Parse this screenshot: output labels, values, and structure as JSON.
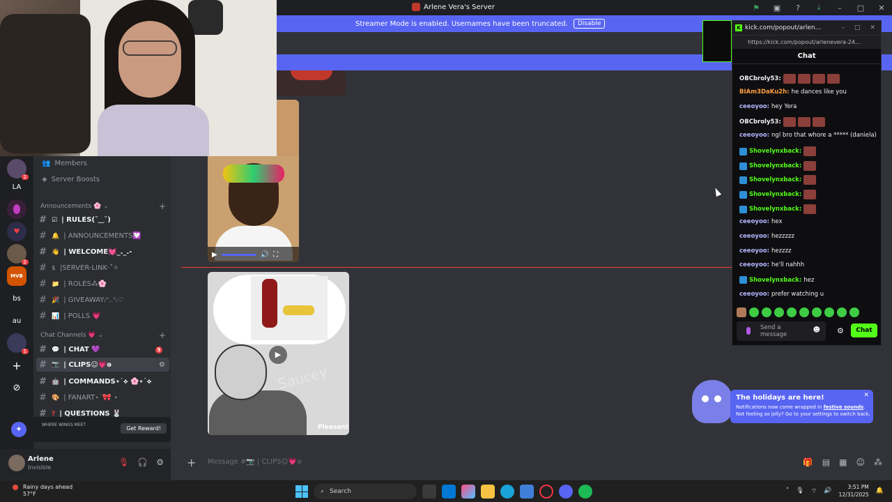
{
  "window": {
    "server_title": "Arlene Vera's Server",
    "streamer_banner": "Streamer Mode is enabled. Usernames have been truncated.",
    "disable_label": "Disable"
  },
  "guilds": [
    {
      "label": "",
      "badge": "2"
    },
    {
      "label": "LA",
      "badge": ""
    },
    {
      "label": "",
      "badge": ""
    },
    {
      "label": "",
      "badge": ""
    },
    {
      "label": "",
      "badge": "2"
    },
    {
      "label": "MVB",
      "badge": ""
    },
    {
      "label": "bs",
      "badge": ""
    },
    {
      "label": "au",
      "badge": ""
    },
    {
      "label": "",
      "badge": "1"
    },
    {
      "label": "+",
      "badge": ""
    },
    {
      "label": "⊘",
      "badge": ""
    }
  ],
  "sidebar": {
    "top_items": [
      {
        "label": "Members"
      },
      {
        "label": "Server Boosts"
      }
    ],
    "category_announcements": "Announcements 🌸",
    "announcement_channels": [
      {
        "label": "| RULES(˘‿˘)",
        "bold": true
      },
      {
        "label": "| ANNOUNCEMENTS💟",
        "bold": false
      },
      {
        "label": "| WELCOME💓_._.-",
        "bold": true
      },
      {
        "label": "|SERVER-LINK·˚✧",
        "bold": false
      },
      {
        "label": "| ROLES⁂🌸",
        "bold": false
      },
      {
        "label": "| GIVEAWAY₍ᐢ..ᐢ₎♡",
        "bold": false
      },
      {
        "label": "| POLLS 💗",
        "bold": false
      }
    ],
    "category_chat": "Chat Channels 💗",
    "chat_channels": [
      {
        "label": "| CHAT 💜",
        "bold": true,
        "badge": "5"
      },
      {
        "label": "| CLIPS☺💗ə",
        "bold": true,
        "badge": ""
      },
      {
        "label": "| COMMANDS⋆˙⟡ 🌸⋆˙⟡",
        "bold": true,
        "badge": ""
      },
      {
        "label": "| FANART⋆˙🎀 ⋆",
        "bold": false,
        "badge": ""
      },
      {
        "label": "| QUESTIONS 🐰",
        "bold": true,
        "badge": ""
      }
    ]
  },
  "promo": {
    "text": "WHERE WINGS MEET",
    "button": "Get Reward!"
  },
  "user": {
    "name": "Arlene",
    "status": "Invisible"
  },
  "composer": {
    "placeholder": "Message #📷 | CLIPS☺💗ə"
  },
  "kick_chat": {
    "window_title": "kick.com/popout/arlen...",
    "url": "https://kick.com/popout/arlenevera-24...",
    "header": "Chat",
    "messages": [
      {
        "user": "OBCbroly53:",
        "text": "",
        "color": "#efeff1",
        "emotes": 4,
        "icon": false
      },
      {
        "user": "BIAm3DaKu2h:",
        "text": "he dances like you",
        "color": "#ff9f43",
        "emotes": 0,
        "icon": false
      },
      {
        "user": "ceeoyoo:",
        "text": "hey Yera",
        "color": "#b3b3ff",
        "emotes": 0,
        "icon": false
      },
      {
        "user": "OBCbroly53:",
        "text": "",
        "color": "#efeff1",
        "emotes": 3,
        "icon": false
      },
      {
        "user": "ceeoyoo:",
        "text": "ngl bro that whore a ***** (daniela)",
        "color": "#b3b3ff",
        "emotes": 0,
        "icon": false
      },
      {
        "user": "Shovelynxback:",
        "text": "",
        "color": "#53fc18",
        "emotes": 1,
        "icon": true
      },
      {
        "user": "Shovelynxback:",
        "text": "",
        "color": "#53fc18",
        "emotes": 1,
        "icon": true
      },
      {
        "user": "Shovelynxback:",
        "text": "",
        "color": "#53fc18",
        "emotes": 1,
        "icon": true
      },
      {
        "user": "Shovelynxback:",
        "text": "",
        "color": "#53fc18",
        "emotes": 1,
        "icon": true
      },
      {
        "user": "Shovelynxback:",
        "text": "",
        "color": "#53fc18",
        "emotes": 1,
        "icon": true
      },
      {
        "user": "ceeoyoo:",
        "text": "hex",
        "color": "#b3b3ff",
        "emotes": 0,
        "icon": false
      },
      {
        "user": "ceeoyoo:",
        "text": "hezzzzz",
        "color": "#b3b3ff",
        "emotes": 0,
        "icon": false
      },
      {
        "user": "ceeoyoo:",
        "text": "hezzzz",
        "color": "#b3b3ff",
        "emotes": 0,
        "icon": false
      },
      {
        "user": "ceeoyoo:",
        "text": "he'll nahhh",
        "color": "#b3b3ff",
        "emotes": 0,
        "icon": false
      },
      {
        "user": "Shovelynxback:",
        "text": "hez",
        "color": "#53fc18",
        "emotes": 0,
        "icon": true
      },
      {
        "user": "ceeoyoo:",
        "text": "prefer watching u",
        "color": "#b3b3ff",
        "emotes": 0,
        "icon": false
      }
    ],
    "send_placeholder": "Send a message",
    "chat_button": "Chat"
  },
  "holiday": {
    "title": "The holidays are here!",
    "body_pre": "Notifications now come wrapped in ",
    "body_link": "festive sounds",
    "body_post": ". Not feeling so jolly? Go to your settings to switch back."
  },
  "media": {
    "watermark": "Saucey",
    "credit": "Pleasant"
  },
  "taskbar": {
    "weather": "Rainy days ahead",
    "temp": "57°F",
    "search": "Search",
    "time": "3:51 PM",
    "date": "12/31/2025"
  },
  "colors": {
    "accent": "#5865f2",
    "kick_green": "#53fc18",
    "danger": "#f23f43"
  }
}
